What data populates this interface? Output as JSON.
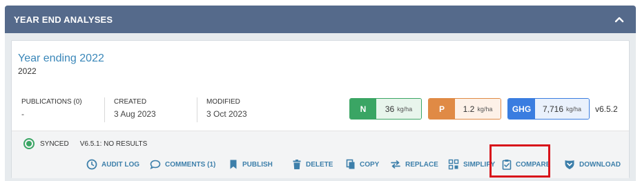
{
  "panel": {
    "title": "YEAR END ANALYSES"
  },
  "card": {
    "title": "Year ending 2022",
    "subtitle": "2022",
    "meta": [
      {
        "label": "PUBLICATIONS (0)",
        "value": "-"
      },
      {
        "label": "CREATED",
        "value": "3 Aug 2023"
      },
      {
        "label": "MODIFIED",
        "value": "3 Oct 2023"
      }
    ],
    "metrics": [
      {
        "tag": "N",
        "value": "36",
        "unit": "kg/ha",
        "color": "#3aa564",
        "bg": "#e8f5ec"
      },
      {
        "tag": "P",
        "value": "1.2",
        "unit": "kg/ha",
        "color": "#e08a45",
        "bg": "#fdf1e8"
      },
      {
        "tag": "GHG",
        "value": "7,716",
        "unit": "kg/ha",
        "color": "#3a7de0",
        "bg": "#eaf1fc"
      }
    ],
    "version": "v6.5.2",
    "status": {
      "sync_label": "SYNCED",
      "result_label": "V6.5.1: NO RESULTS"
    },
    "actions": [
      {
        "label": "AUDIT LOG",
        "icon": "clock-icon"
      },
      {
        "label": "COMMENTS (1)",
        "icon": "comment-icon"
      },
      {
        "label": "PUBLISH",
        "icon": "bookmark-icon"
      },
      {
        "label": "DELETE",
        "icon": "trash-icon"
      },
      {
        "label": "COPY",
        "icon": "copy-icon"
      },
      {
        "label": "REPLACE",
        "icon": "swap-icon"
      },
      {
        "label": "SIMPLIFY",
        "icon": "simplify-icon"
      },
      {
        "label": "COMPARE",
        "icon": "clipboard-check-icon"
      },
      {
        "label": "DOWNLOAD",
        "icon": "shield-download-icon"
      }
    ]
  },
  "colors": {
    "header": "#556a8b",
    "link": "#3d7faa",
    "highlight": "#d8131a"
  }
}
